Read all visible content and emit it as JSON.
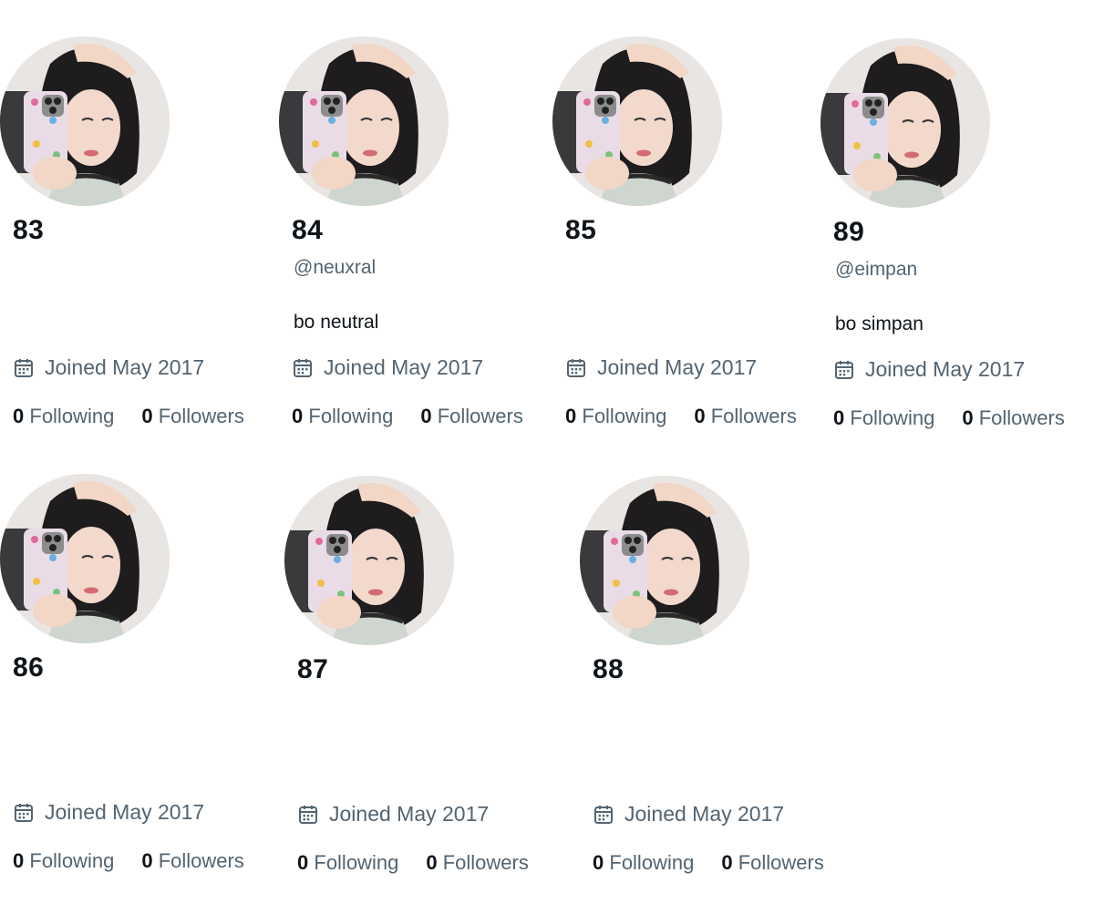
{
  "profiles": [
    {
      "name": "83",
      "handle": "",
      "bio": "",
      "joined": "Joined May 2017",
      "following_count": "0",
      "following_label": "Following",
      "followers_count": "0",
      "followers_label": "Followers"
    },
    {
      "name": "84",
      "handle": "@neuxral",
      "bio": "bo neutral",
      "joined": "Joined May 2017",
      "following_count": "0",
      "following_label": "Following",
      "followers_count": "0",
      "followers_label": "Followers"
    },
    {
      "name": "85",
      "handle": "",
      "bio": "",
      "joined": "Joined May 2017",
      "following_count": "0",
      "following_label": "Following",
      "followers_count": "0",
      "followers_label": "Followers"
    },
    {
      "name": "89",
      "handle": "@eimpan",
      "bio": "bo simpan",
      "joined": "Joined May 2017",
      "following_count": "0",
      "following_label": "Following",
      "followers_count": "0",
      "followers_label": "Followers"
    },
    {
      "name": "86",
      "handle": "",
      "bio": "",
      "joined": "Joined May 2017",
      "following_count": "0",
      "following_label": "Following",
      "followers_count": "0",
      "followers_label": "Followers"
    },
    {
      "name": "87",
      "handle": "",
      "bio": "",
      "joined": "Joined May 2017",
      "following_count": "0",
      "following_label": "Following",
      "followers_count": "0",
      "followers_label": "Followers"
    },
    {
      "name": "88",
      "handle": "",
      "bio": "",
      "joined": "Joined May 2017",
      "following_count": "0",
      "following_label": "Following",
      "followers_count": "0",
      "followers_label": "Followers"
    }
  ],
  "icons": {
    "joined": "calendar-icon",
    "avatar": "profile-photo"
  },
  "colors": {
    "primary_text": "#0f1419",
    "secondary_text": "#536471"
  }
}
